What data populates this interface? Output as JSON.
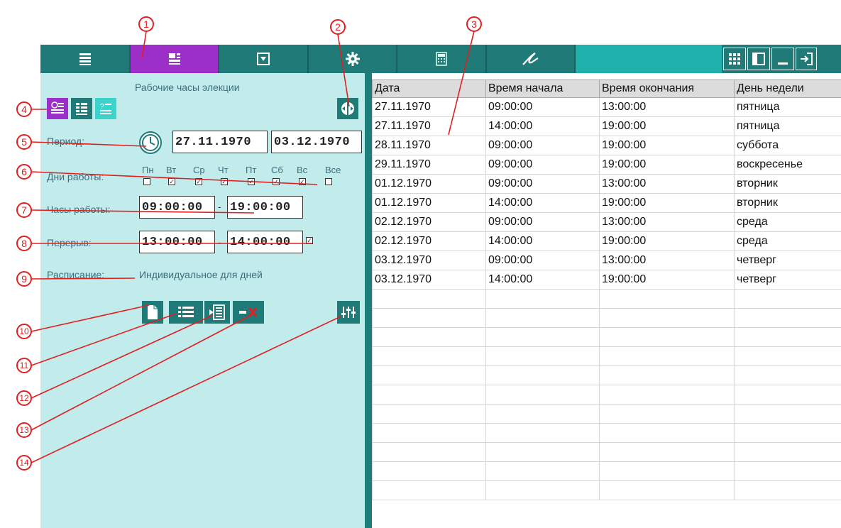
{
  "toolbar": {
    "tabs": [
      {
        "icon": "list-icon"
      },
      {
        "icon": "dashboard-icon",
        "active": true
      },
      {
        "icon": "dropdown-box-icon"
      },
      {
        "icon": "gear-icon"
      },
      {
        "icon": "calculator-icon"
      },
      {
        "icon": "signature-icon"
      }
    ],
    "right_buttons": [
      "grid-icon",
      "panel-icon",
      "minimize-icon",
      "exit-icon"
    ],
    "colors": {
      "bar": "#1f7a78",
      "active": "#9b2fc7",
      "fill": "#1fb0ab"
    }
  },
  "panel": {
    "title": "Рабочие часы элекции",
    "period_label": "Период:",
    "period_from": "27.11.1970",
    "period_to": "03.12.1970",
    "days_label": "Дни работы:",
    "days": [
      "Пн",
      "Вт",
      "Ср",
      "Чт",
      "Пт",
      "Сб",
      "Вс",
      "Все"
    ],
    "days_checked": [
      false,
      true,
      true,
      true,
      true,
      true,
      true,
      false
    ],
    "hours_label": "Часы работы:",
    "hours_from": "09:00:00",
    "hours_to": "19:00:00",
    "break_label": "Перерыв:",
    "break_from": "13:00:00",
    "break_to": "14:00:00",
    "break_enabled": true,
    "separator": "-",
    "schedule_label": "Расписание:",
    "schedule_value": "Индивидуальное для дней",
    "background": "#c2ecec"
  },
  "table": {
    "columns": [
      "Дата",
      "Время начала",
      "Время окончания",
      "День недели"
    ],
    "rows": [
      [
        "27.11.1970",
        "09:00:00",
        "13:00:00",
        "пятница"
      ],
      [
        "27.11.1970",
        "14:00:00",
        "19:00:00",
        "пятница"
      ],
      [
        "28.11.1970",
        "09:00:00",
        "19:00:00",
        "суббота"
      ],
      [
        "29.11.1970",
        "09:00:00",
        "19:00:00",
        "воскресенье"
      ],
      [
        "01.12.1970",
        "09:00:00",
        "13:00:00",
        "вторник"
      ],
      [
        "01.12.1970",
        "14:00:00",
        "19:00:00",
        "вторник"
      ],
      [
        "02.12.1970",
        "09:00:00",
        "13:00:00",
        "среда"
      ],
      [
        "02.12.1970",
        "14:00:00",
        "19:00:00",
        "среда"
      ],
      [
        "03.12.1970",
        "09:00:00",
        "13:00:00",
        "четверг"
      ],
      [
        "03.12.1970",
        "14:00:00",
        "19:00:00",
        "четверг"
      ]
    ],
    "empty_rows": 11
  },
  "callouts": [
    "1",
    "2",
    "3",
    "4",
    "5",
    "6",
    "7",
    "8",
    "9",
    "10",
    "11",
    "12",
    "13",
    "14"
  ],
  "callout_color": "#e02020"
}
